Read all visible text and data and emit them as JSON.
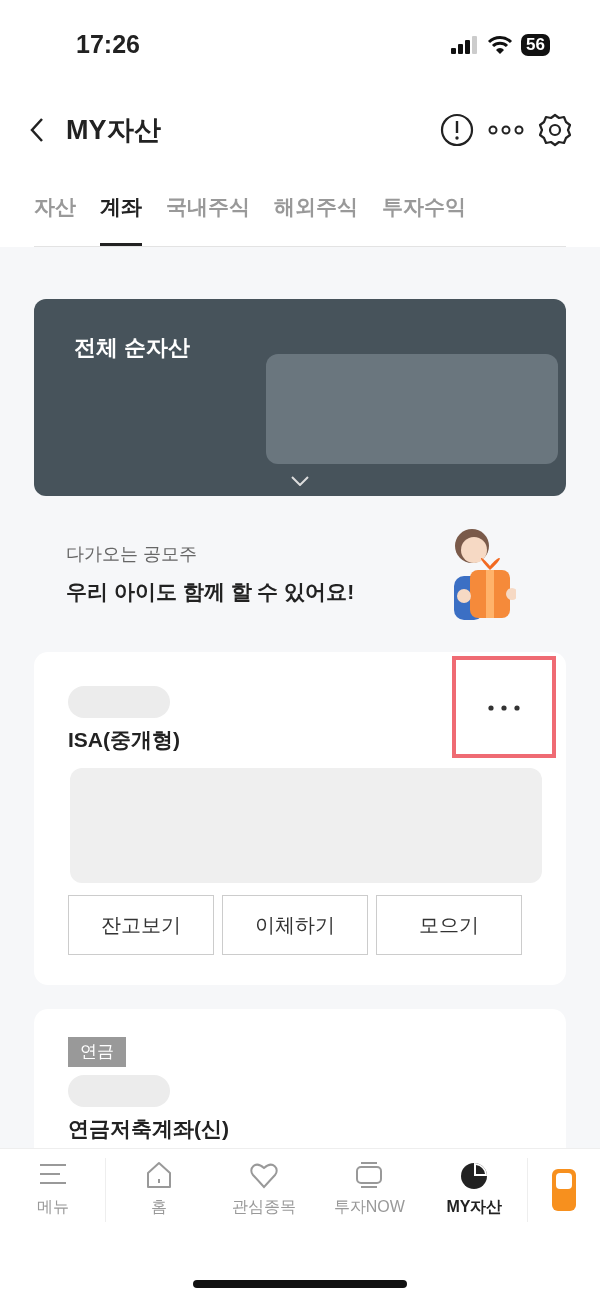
{
  "status_bar": {
    "time": "17:26",
    "battery": "56"
  },
  "header": {
    "title": "MY자산"
  },
  "tabs": [
    {
      "label": "자산",
      "selected": false
    },
    {
      "label": "계좌",
      "selected": true
    },
    {
      "label": "국내주식",
      "selected": false
    },
    {
      "label": "해외주식",
      "selected": false
    },
    {
      "label": "투자수익",
      "selected": false
    }
  ],
  "net_assets": {
    "title": "전체 순자산"
  },
  "promo": {
    "subtitle": "다가오는 공모주",
    "title": "우리 아이도 함께 할 수 있어요!"
  },
  "accounts": [
    {
      "name": "ISA(중개형)",
      "more_highlighted": true,
      "buttons": [
        "잔고보기",
        "이체하기",
        "모으기"
      ]
    },
    {
      "tag": "연금",
      "name": "연금저축계좌(신)"
    }
  ],
  "bottom_nav": [
    {
      "label": "메뉴",
      "kind": "menu",
      "selected": false
    },
    {
      "label": "홈",
      "kind": "home",
      "selected": false
    },
    {
      "label": "관심종목",
      "kind": "heart",
      "selected": false
    },
    {
      "label": "투자NOW",
      "kind": "cards",
      "selected": false
    },
    {
      "label": "MY자산",
      "kind": "pie",
      "selected": true
    }
  ]
}
